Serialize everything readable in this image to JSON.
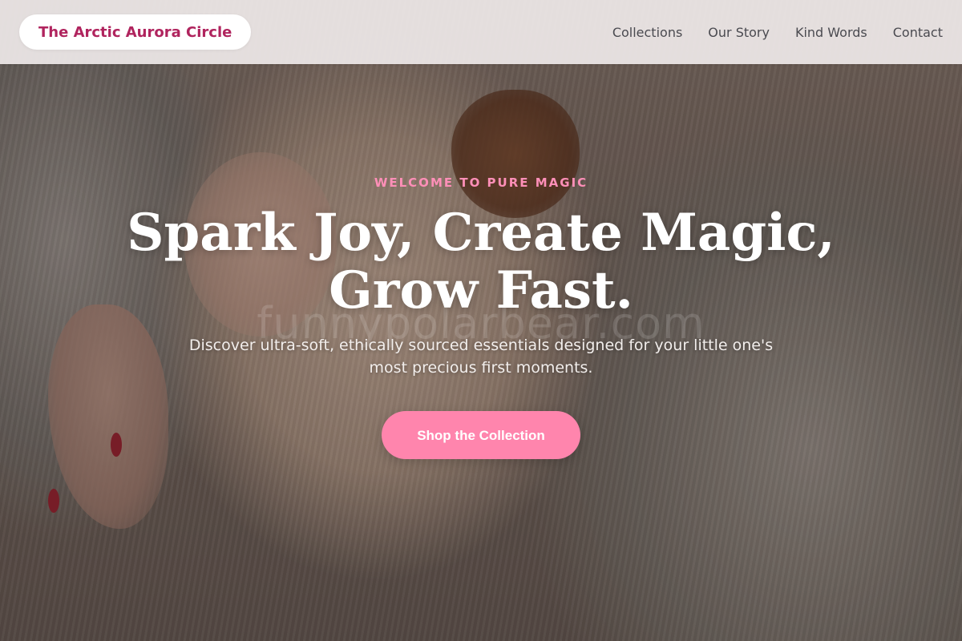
{
  "brand": {
    "name": "The Arctic Aurora Circle",
    "color": "#b0245e"
  },
  "nav": {
    "items": [
      {
        "label": "Collections"
      },
      {
        "label": "Our Story"
      },
      {
        "label": "Kind Words"
      },
      {
        "label": "Contact"
      }
    ]
  },
  "hero": {
    "eyebrow": "WELCOME TO PURE MAGIC",
    "headline_line1": "Spark Joy, Create Magic,",
    "headline_line2": "Grow Fast.",
    "subtext": "Discover ultra-soft, ethically sourced essentials designed for your little one's most precious first moments.",
    "cta_label": "Shop the Collection",
    "watermark": "funnypolarbear.com",
    "background_image": "baby-in-knit-bear-sweater-photo"
  },
  "colors": {
    "accent": "#ff85ad",
    "eyebrow": "#ff8fb8",
    "header_bg": "#eee8e8"
  }
}
